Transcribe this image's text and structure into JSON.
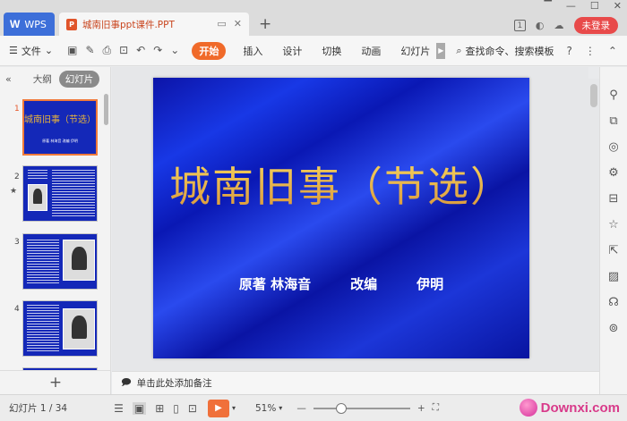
{
  "titlebar": {
    "app_tab": "WPS",
    "app_logo": "W",
    "doc_tab_title": "城南旧事ppt课件.PPT",
    "doc_icon_letter": "P",
    "tab_count_badge": "1",
    "login_label": "未登录",
    "icons": [
      "desktop-icon",
      "close-icon",
      "add-tab-icon",
      "minimize-icon",
      "maximize-icon",
      "window-close-icon",
      "skin-icon",
      "cloud-icon"
    ]
  },
  "ribbon": {
    "file_menu": "文件",
    "start_tab": "开始",
    "tabs": [
      "插入",
      "设计",
      "切换",
      "动画",
      "幻灯片"
    ],
    "search_label": "查找命令、搜索模板",
    "help": "?"
  },
  "leftpanel": {
    "outline_tab": "大纲",
    "slides_tab": "幻灯片",
    "thumbnails": [
      {
        "num": "1",
        "title": "城南旧事（节选）",
        "byline": "原著 林海音   改编   伊明"
      },
      {
        "num": "2"
      },
      {
        "num": "3"
      },
      {
        "num": "4"
      }
    ],
    "add_slide": "+"
  },
  "slide": {
    "title": "城南旧事（节选）",
    "byline_parts": [
      "原著  林海音",
      "改编",
      "伊明"
    ]
  },
  "notes": {
    "placeholder": "单击此处添加备注"
  },
  "statusbar": {
    "slide_info": "幻灯片 1 / 34",
    "zoom": "51%",
    "zoom_fraction": 0.29,
    "watermark": "Downxi.com"
  },
  "colors": {
    "accent_orange": "#f06a2a",
    "wps_blue": "#3d6fd9",
    "login_red": "#e84a4a",
    "slide_blue": "#1428b8",
    "title_gold": "#f0c040"
  }
}
